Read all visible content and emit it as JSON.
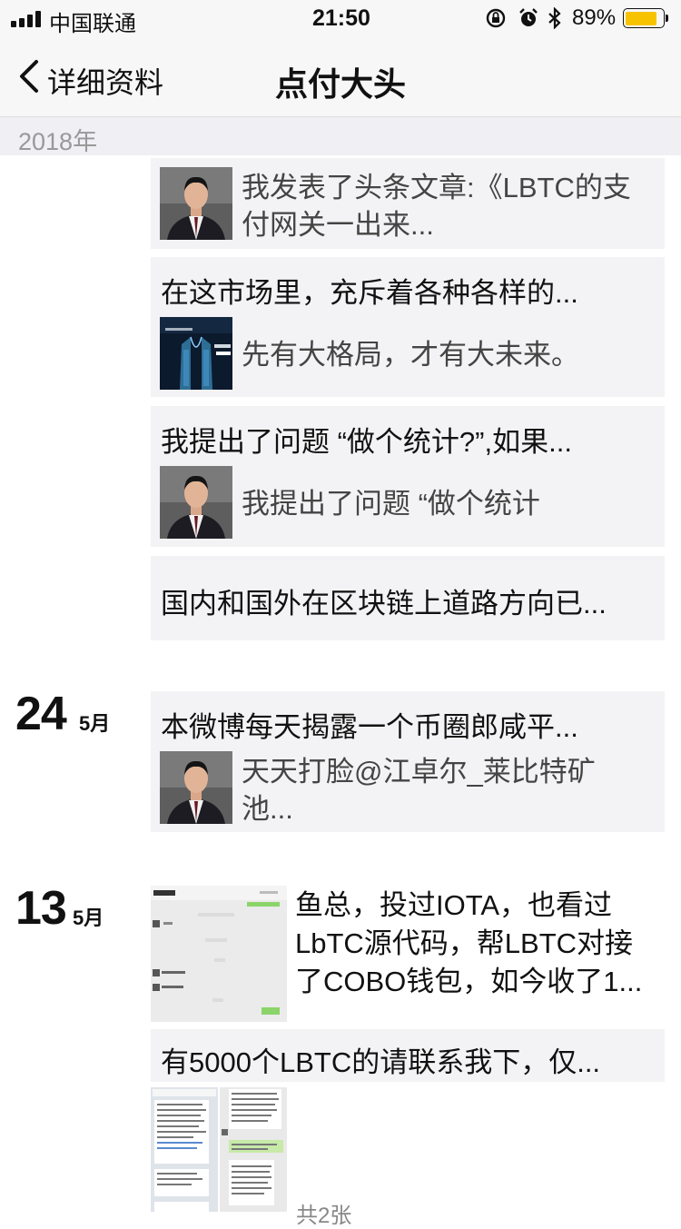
{
  "status_bar": {
    "carrier": "中国联通",
    "time": "21:50",
    "battery_percent": "89%",
    "battery_level": 0.89,
    "battery_color": "#f7c300"
  },
  "nav": {
    "back_label": "详细资料",
    "title": "点付大头"
  },
  "year_header": "2018年",
  "posts": [
    {
      "share_text": "我发表了头条文章:《LBTC的支付网关一出来..."
    },
    {
      "headline": "在这市场里，充斥着各种各样的...",
      "share_text": "先有大格局，才有大未来。"
    },
    {
      "headline": "我提出了问题 “做个统计?”,如果...",
      "share_text": "我提出了问题 “做个统计"
    },
    {
      "headline": "国内和国外在区块链上道路方向已..."
    }
  ],
  "day_24": {
    "day": "24",
    "month": "5月",
    "posts": [
      {
        "headline": "本微博每天揭露一个币圈郎咸平...",
        "share_text": "天天打脸@江卓尔_莱比特矿池..."
      }
    ]
  },
  "day_13": {
    "day": "13",
    "month": "5月",
    "posts": [
      {
        "text": "鱼总，投过IOTA，也看过LbTC源代码，帮LBTC对接了COBO钱包，如今收了1..."
      },
      {
        "headline": "有5000个LBTC的请联系我下，仅...",
        "image_count": "共2张"
      }
    ]
  }
}
